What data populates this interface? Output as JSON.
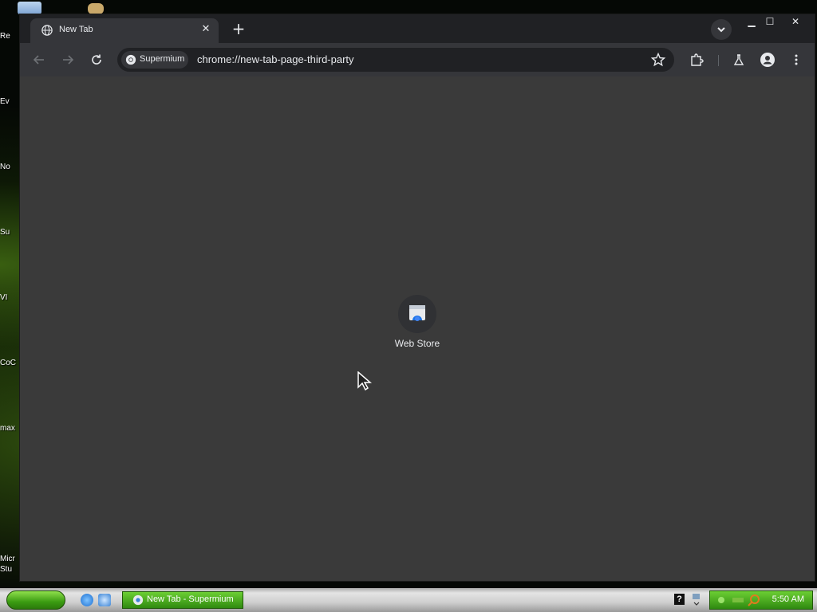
{
  "desktop": {
    "icons": [
      {
        "label": "Re"
      },
      {
        "label": "Ev"
      },
      {
        "label": "No"
      },
      {
        "label": "Su"
      },
      {
        "label": "VI"
      },
      {
        "label": "CoC"
      },
      {
        "label": "max"
      },
      {
        "label": "Micr"
      },
      {
        "label": "Stu"
      }
    ]
  },
  "browser": {
    "tab": {
      "title": "New Tab",
      "favicon": "globe-icon",
      "close_icon": "close-icon"
    },
    "new_tab_icon": "plus-icon",
    "tab_search_icon": "chevron-down-icon",
    "window_controls": {
      "minimize": "minimize-icon",
      "maximize": "maximize-icon",
      "close": "close-icon"
    },
    "toolbar": {
      "back_icon": "arrow-left-icon",
      "forward_icon": "arrow-right-icon",
      "reload_icon": "reload-icon",
      "site_chip_label": "Supermium",
      "url": "chrome://new-tab-page-third-party",
      "bookmark_icon": "star-icon",
      "extensions_icon": "puzzle-icon",
      "labs_icon": "flask-icon",
      "profile_icon": "person-icon",
      "menu_icon": "kebab-menu-icon"
    },
    "content": {
      "shortcuts": [
        {
          "label": "Web Store",
          "icon": "web-store-icon"
        }
      ]
    }
  },
  "taskbar": {
    "task_label": "New Tab - Supermium",
    "help_label": "?",
    "clock": "5:50 AM"
  },
  "colors": {
    "window_bg": "#3a3a3a",
    "tabstrip_bg": "#202124",
    "toolbar_bg": "#35363a",
    "text": "#e8eaed",
    "taskbar_green": "#3b9c12"
  }
}
